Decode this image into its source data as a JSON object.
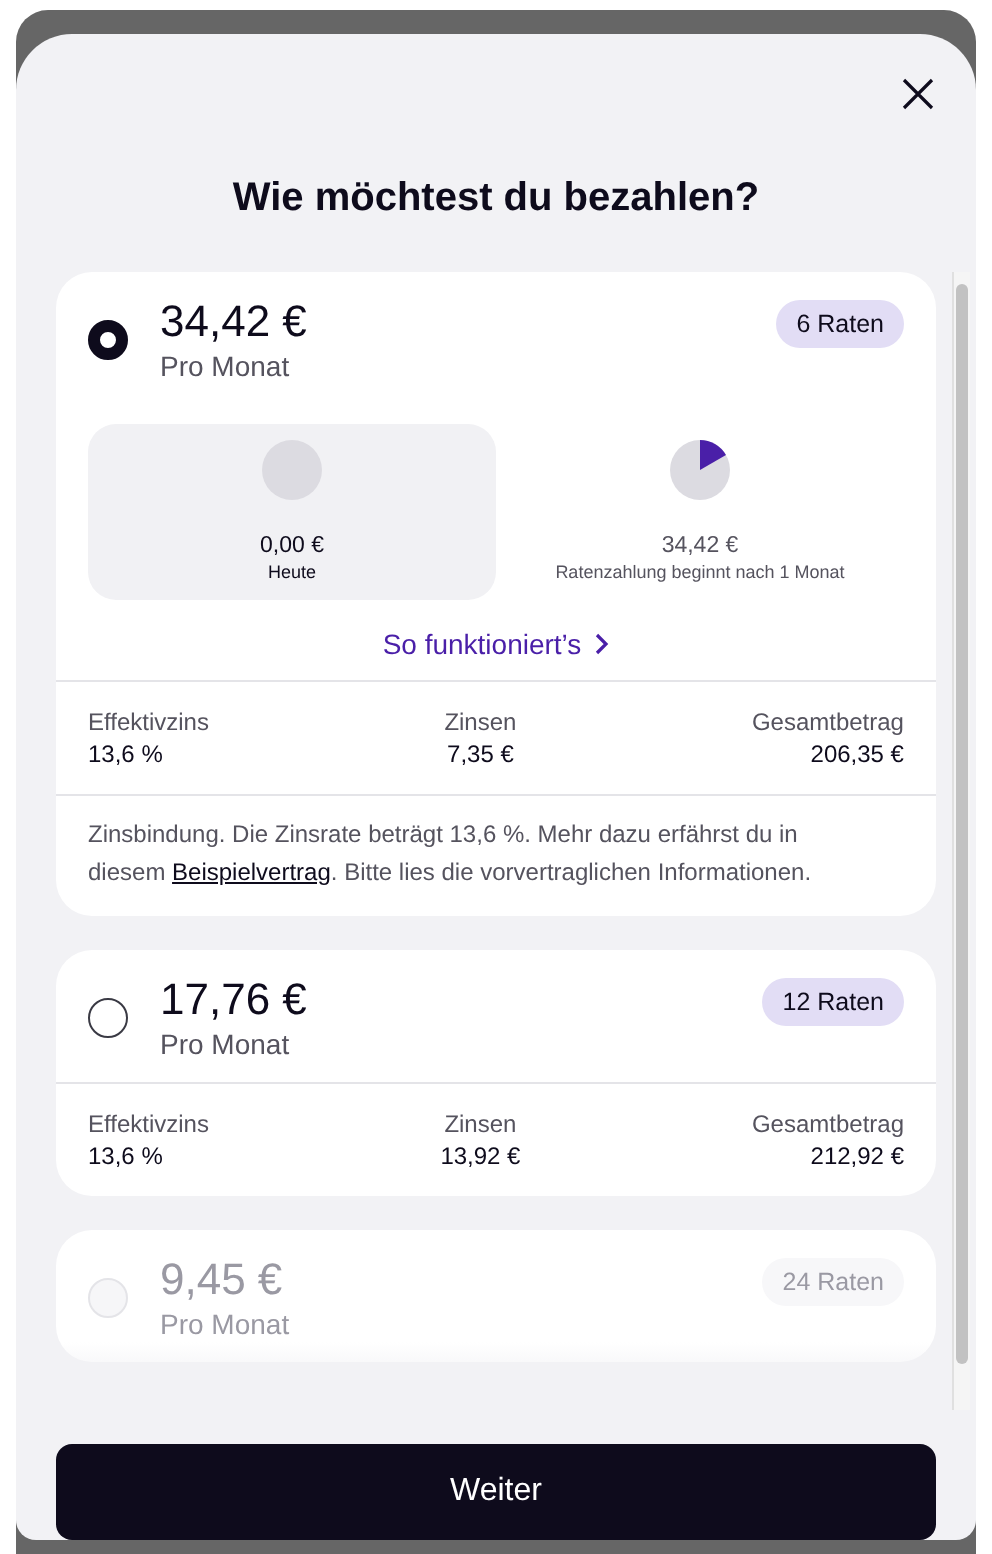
{
  "title": "Wie möchtest du bezahlen?",
  "options": [
    {
      "selected": true,
      "disabled": false,
      "amount": "34,42 €",
      "per": "Pro Monat",
      "badge": "6 Raten",
      "schedule": [
        {
          "amount": "0,00 €",
          "label": "Heute",
          "selected": true,
          "kind": "empty"
        },
        {
          "amount": "34,42 €",
          "label": "Ratenzahlung beginnt nach 1 Monat",
          "selected": false,
          "kind": "started"
        }
      ],
      "link": "So funktioniert’s",
      "stats": [
        {
          "label": "Effektivzins",
          "value": "13,6 %"
        },
        {
          "label": "Zinsen",
          "value": "7,35 €"
        },
        {
          "label": "Gesamtbetrag",
          "value": "206,35 €"
        }
      ],
      "note_before": "Zinsbindung. Die Zinsrate beträgt 13,6 %. Mehr dazu erfährst du in diesem ",
      "note_link": "Beispielvertrag",
      "note_after": ". Bitte lies die vorvertraglichen Informationen."
    },
    {
      "selected": false,
      "disabled": false,
      "amount": "17,76 €",
      "per": "Pro Monat",
      "badge": "12 Raten",
      "stats": [
        {
          "label": "Effektivzins",
          "value": "13,6 %"
        },
        {
          "label": "Zinsen",
          "value": "13,92 €"
        },
        {
          "label": "Gesamtbetrag",
          "value": "212,92 €"
        }
      ]
    },
    {
      "selected": false,
      "disabled": true,
      "amount": "9,45 €",
      "per": "Pro Monat",
      "badge": "24 Raten"
    }
  ],
  "button": "Weiter"
}
